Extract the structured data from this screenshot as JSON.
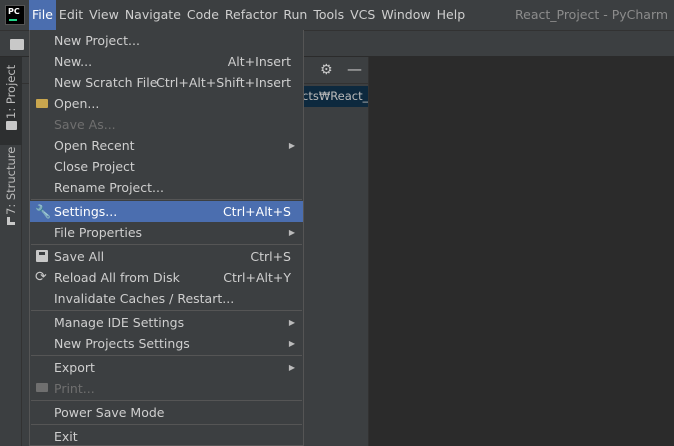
{
  "app": {
    "logo_text": "PC",
    "window_title": "React_Project - PyCharm"
  },
  "menubar": {
    "items": [
      "File",
      "Edit",
      "View",
      "Navigate",
      "Code",
      "Refactor",
      "Run",
      "Tools",
      "VCS",
      "Window",
      "Help"
    ]
  },
  "left_strip": {
    "project_tab": "1: Project",
    "structure_tab": "7: Structure"
  },
  "project_panel": {
    "path_text": "cts₩React_P"
  },
  "file_menu": {
    "items": [
      {
        "label": "New Project...",
        "shortcut": "",
        "state": "normal",
        "submenu": false,
        "icon": ""
      },
      {
        "label": "New...",
        "shortcut": "Alt+Insert",
        "state": "normal",
        "submenu": false,
        "icon": ""
      },
      {
        "label": "New Scratch File",
        "shortcut": "Ctrl+Alt+Shift+Insert",
        "state": "normal",
        "submenu": false,
        "icon": ""
      },
      {
        "label": "Open...",
        "shortcut": "",
        "state": "normal",
        "submenu": false,
        "icon": "folder-open-icon"
      },
      {
        "label": "Save As...",
        "shortcut": "",
        "state": "disabled",
        "submenu": false,
        "icon": ""
      },
      {
        "label": "Open Recent",
        "shortcut": "",
        "state": "normal",
        "submenu": true,
        "icon": ""
      },
      {
        "label": "Close Project",
        "shortcut": "",
        "state": "normal",
        "submenu": false,
        "icon": ""
      },
      {
        "label": "Rename Project...",
        "shortcut": "",
        "state": "normal",
        "submenu": false,
        "icon": ""
      },
      {
        "label": "Settings...",
        "shortcut": "Ctrl+Alt+S",
        "state": "selected",
        "submenu": false,
        "icon": "wrench-icon"
      },
      {
        "label": "File Properties",
        "shortcut": "",
        "state": "normal",
        "submenu": true,
        "icon": ""
      },
      {
        "label": "Save All",
        "shortcut": "Ctrl+S",
        "state": "normal",
        "submenu": false,
        "icon": "save-icon"
      },
      {
        "label": "Reload All from Disk",
        "shortcut": "Ctrl+Alt+Y",
        "state": "normal",
        "submenu": false,
        "icon": "reload-icon"
      },
      {
        "label": "Invalidate Caches / Restart...",
        "shortcut": "",
        "state": "normal",
        "submenu": false,
        "icon": ""
      },
      {
        "label": "Manage IDE Settings",
        "shortcut": "",
        "state": "normal",
        "submenu": true,
        "icon": ""
      },
      {
        "label": "New Projects Settings",
        "shortcut": "",
        "state": "normal",
        "submenu": true,
        "icon": ""
      },
      {
        "label": "Export",
        "shortcut": "",
        "state": "normal",
        "submenu": true,
        "icon": ""
      },
      {
        "label": "Print...",
        "shortcut": "",
        "state": "disabled",
        "submenu": false,
        "icon": "print-icon"
      },
      {
        "label": "Power Save Mode",
        "shortcut": "",
        "state": "normal",
        "submenu": false,
        "icon": ""
      },
      {
        "label": "Exit",
        "shortcut": "",
        "state": "normal",
        "submenu": false,
        "icon": ""
      }
    ]
  },
  "colors": {
    "selection": "#4b6eaf",
    "menu_bg": "#3c3f41",
    "editor_bg": "#2b2b2b"
  }
}
